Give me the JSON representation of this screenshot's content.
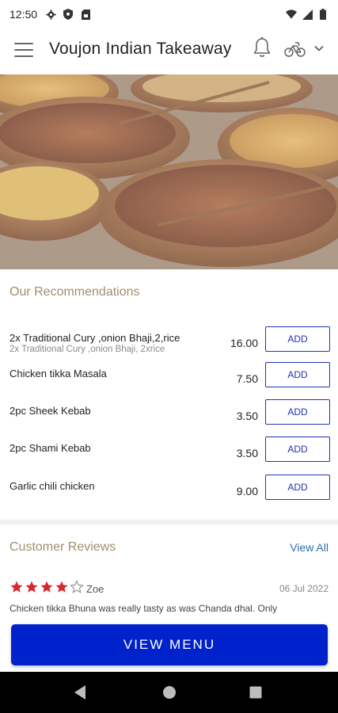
{
  "status_bar": {
    "time": "12:50",
    "left_icons": [
      "gear-icon",
      "shield-icon",
      "sim-card-icon"
    ],
    "right_icons": [
      "wifi-icon",
      "signal-icon",
      "battery-icon"
    ]
  },
  "app_bar": {
    "title": "Voujon Indian Takeaway",
    "icons": [
      "menu-icon",
      "bell-icon",
      "bike-icon",
      "chevron-down-icon"
    ]
  },
  "recommendations": {
    "title": "Our Recommendations",
    "add_label": "ADD",
    "items": [
      {
        "name": "2x Traditional Cury ,onion Bhaji,2,rice",
        "description": "2x Traditional Cury ,onion Bhaji, 2xrice",
        "price": "16.00"
      },
      {
        "name": "Chicken tikka Masala",
        "description": "",
        "price": "7.50"
      },
      {
        "name": "2pc Sheek Kebab",
        "description": "",
        "price": "3.50"
      },
      {
        "name": "2pc Shami Kebab",
        "description": "",
        "price": "3.50"
      },
      {
        "name": "Garlic chili chicken",
        "description": "",
        "price": "9.00"
      }
    ]
  },
  "reviews": {
    "title": "Customer Reviews",
    "view_all": "View All",
    "items": [
      {
        "rating": 4,
        "max_rating": 5,
        "reviewer": "Zoe",
        "date": "06 Jul 2022",
        "text": "Chicken tikka Bhuna was really tasty as was Chanda dhal.  Only"
      }
    ]
  },
  "cta": {
    "label": "VIEW MENU"
  },
  "colors": {
    "accent_blue": "#0022cc",
    "add_button_blue": "#2233b5",
    "section_title_gold": "#a48d6a",
    "star_red": "#d6282e",
    "link_blue": "#2f6fb0"
  }
}
